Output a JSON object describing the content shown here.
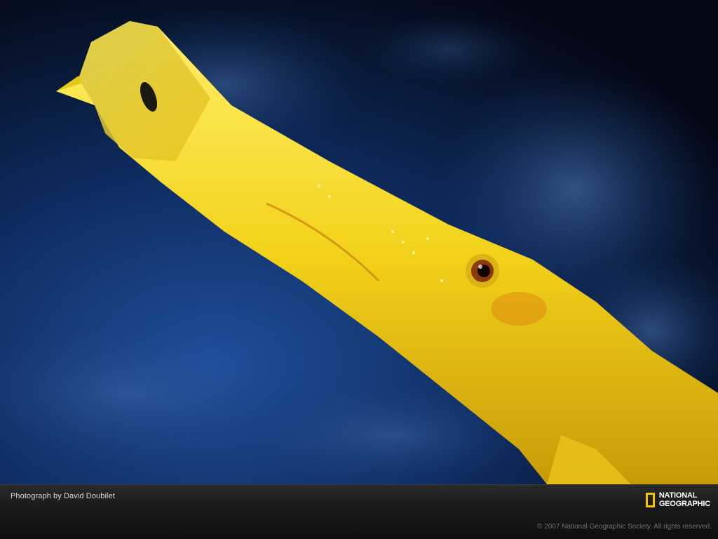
{
  "photo": {
    "subject": "yellow trumpetfish underwater",
    "colors": {
      "water_deep": "#050a1a",
      "water_mid": "#0d2a5c",
      "fish_main": "#f2d21a",
      "fish_shadow": "#c99a0a",
      "fish_highlight": "#fff27a"
    }
  },
  "caption": {
    "credit": "Photograph by David Doubilet",
    "copyright": "© 2007 National Geographic Society. All rights reserved."
  },
  "logo": {
    "line1": "NATIONAL",
    "line2": "GEOGRAPHIC",
    "frame_color": "#f5c400"
  }
}
